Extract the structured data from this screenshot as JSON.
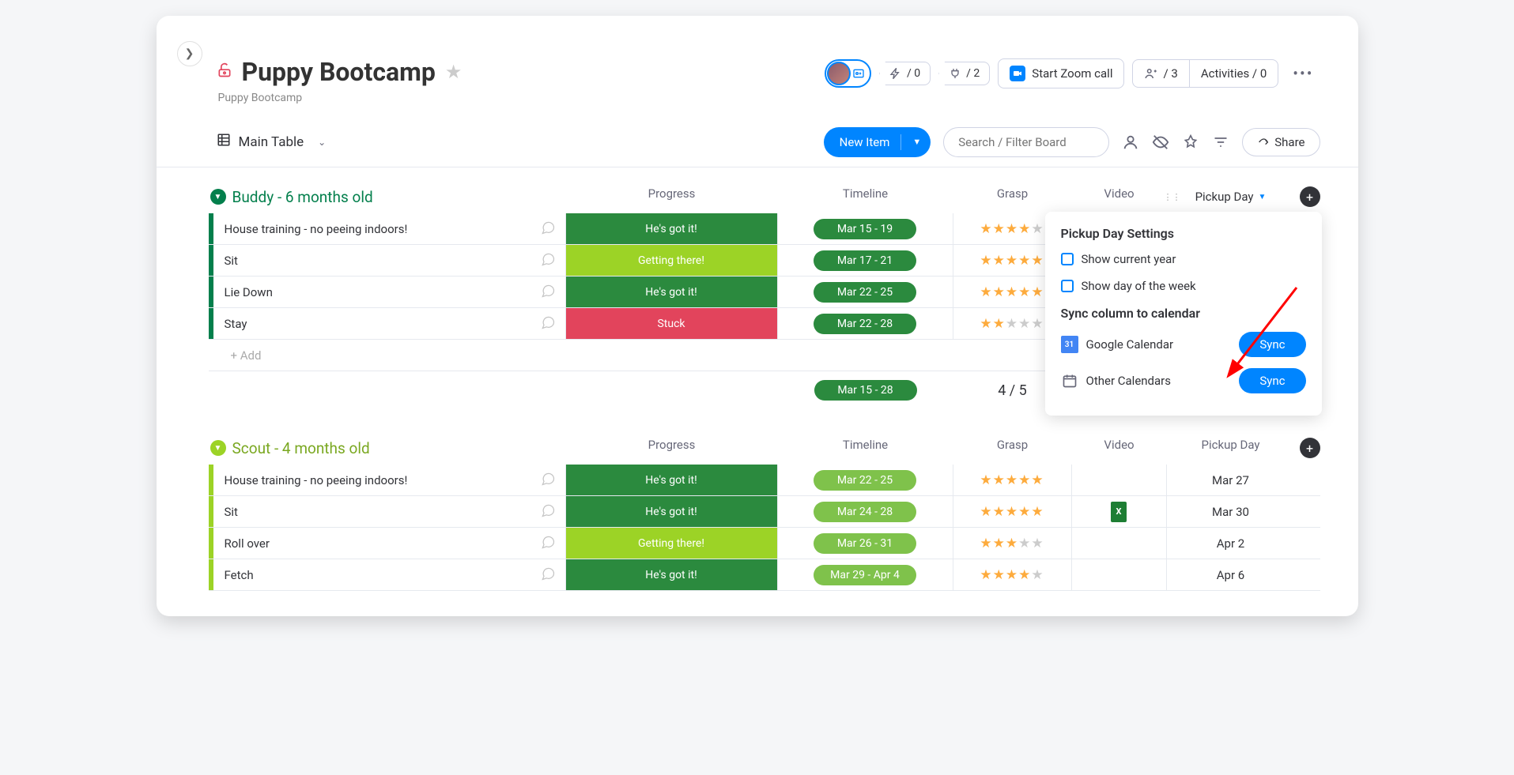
{
  "header": {
    "title": "Puppy Bootcamp",
    "subtitle": "Puppy Bootcamp",
    "automations_counter": "/ 0",
    "integrations_counter": "/ 2",
    "zoom_label": "Start Zoom call",
    "people_counter": "/ 3",
    "activities_label": "Activities / 0"
  },
  "toolbar": {
    "view_label": "Main Table",
    "new_item_label": "New Item",
    "search_placeholder": "Search / Filter Board",
    "share_label": "Share"
  },
  "columns": {
    "progress": "Progress",
    "timeline": "Timeline",
    "grasp": "Grasp",
    "video": "Video",
    "pickup": "Pickup Day"
  },
  "progress_labels": {
    "got": "He's got it!",
    "getting": "Getting there!",
    "stuck": "Stuck"
  },
  "groups": [
    {
      "title": "Buddy - 6 months old",
      "rows": [
        {
          "name": "House training - no peeing indoors!",
          "progress": "got",
          "timeline": "Mar 15 - 19",
          "timeline_style": "dark",
          "stars": 4,
          "pickup": ""
        },
        {
          "name": "Sit",
          "progress": "getting",
          "timeline": "Mar 17 - 21",
          "timeline_style": "dark",
          "stars": 5,
          "pickup": ""
        },
        {
          "name": "Lie Down",
          "progress": "got",
          "timeline": "Mar 22 - 25",
          "timeline_style": "dark",
          "stars": 5,
          "pickup": ""
        },
        {
          "name": "Stay",
          "progress": "stuck",
          "timeline": "Mar 22 - 28",
          "timeline_style": "dark",
          "stars": 2,
          "pickup": ""
        }
      ],
      "add_label": "+ Add",
      "summary_timeline": "Mar 15 - 28",
      "summary_grasp": "4 / 5"
    },
    {
      "title": "Scout - 4 months old",
      "rows": [
        {
          "name": "House training - no peeing indoors!",
          "progress": "got",
          "timeline": "Mar 22 - 25",
          "timeline_style": "light",
          "stars": 5,
          "pickup": "Mar 27"
        },
        {
          "name": "Sit",
          "progress": "got",
          "timeline": "Mar 24 - 28",
          "timeline_style": "light",
          "stars": 5,
          "pickup": "Mar 30",
          "has_file": true
        },
        {
          "name": "Roll over",
          "progress": "getting",
          "timeline": "Mar 26 - 31",
          "timeline_style": "light",
          "stars": 3,
          "pickup": "Apr 2"
        },
        {
          "name": "Fetch",
          "progress": "got",
          "timeline": "Mar 29 - Apr 4",
          "timeline_style": "light",
          "stars": 4,
          "pickup": "Apr 6"
        }
      ]
    }
  ],
  "popover": {
    "title": "Pickup Day Settings",
    "opt1": "Show current year",
    "opt2": "Show day of the week",
    "sync_title": "Sync column to calendar",
    "gcal": "Google Calendar",
    "ocal": "Other Calendars",
    "sync_btn": "Sync",
    "gcal_day": "31"
  }
}
